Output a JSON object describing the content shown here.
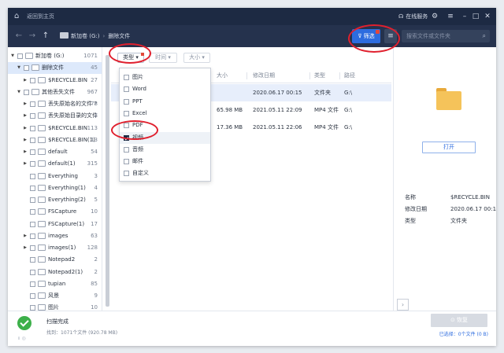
{
  "titlebar": {
    "home_icon": "home-icon",
    "back_home": "返回到主页",
    "online_service": "在线服务",
    "buttons": [
      "gear-icon",
      "menu-icon",
      "minimize-icon",
      "maximize-icon",
      "close-icon"
    ]
  },
  "navbar": {
    "path": [
      "新加卷 (G:)",
      "删除文件"
    ],
    "filter_label": "筛选",
    "search_placeholder": "搜索文件或文件夹"
  },
  "tree": [
    {
      "label": "新加卷 (G:)",
      "count": "1071",
      "level": 0,
      "expanded": true
    },
    {
      "label": "删除文件",
      "count": "45",
      "level": 1,
      "expanded": true,
      "selected": true
    },
    {
      "label": "$RECYCLE.BIN",
      "count": "27",
      "level": 2,
      "expanded": false
    },
    {
      "label": "其他丢失文件",
      "count": "967",
      "level": 1,
      "expanded": true
    },
    {
      "label": "丢失原始名的文件 ?",
      "count": "78",
      "level": 2,
      "expanded": false
    },
    {
      "label": "丢失原始目录的文件",
      "count": "2",
      "level": 2,
      "expanded": false
    },
    {
      "label": "$RECYCLE.BIN",
      "count": "113",
      "level": 2,
      "expanded": false
    },
    {
      "label": "$RECYCLE.BIN(1)",
      "count": "13",
      "level": 2,
      "expanded": false
    },
    {
      "label": "default",
      "count": "54",
      "level": 2,
      "expanded": false
    },
    {
      "label": "default(1)",
      "count": "315",
      "level": 2,
      "expanded": false
    },
    {
      "label": "Everything",
      "count": "3",
      "level": 2
    },
    {
      "label": "Everything(1)",
      "count": "4",
      "level": 2
    },
    {
      "label": "Everything(2)",
      "count": "5",
      "level": 2
    },
    {
      "label": "FSCapture",
      "count": "10",
      "level": 2
    },
    {
      "label": "FSCapture(1)",
      "count": "17",
      "level": 2
    },
    {
      "label": "images",
      "count": "63",
      "level": 2,
      "expanded": false
    },
    {
      "label": "images(1)",
      "count": "128",
      "level": 2,
      "expanded": false
    },
    {
      "label": "Notepad2",
      "count": "2",
      "level": 2
    },
    {
      "label": "Notepad2(1)",
      "count": "2",
      "level": 2
    },
    {
      "label": "tupian",
      "count": "85",
      "level": 2
    },
    {
      "label": "风景",
      "count": "9",
      "level": 2
    },
    {
      "label": "图片",
      "count": "10",
      "level": 2
    }
  ],
  "list": {
    "filters": [
      "类型",
      "时间",
      "大小"
    ],
    "columns": [
      "大小",
      "修改日期",
      "类型",
      "路径"
    ],
    "rows": [
      {
        "size": "",
        "date": "2020.06.17 00:15",
        "type": "文件夹",
        "path": "G:\\"
      },
      {
        "size": "65.98 MB",
        "date": "2021.05.11 22:09",
        "type": "MP4 文件",
        "path": "G:\\"
      },
      {
        "size": "17.36 MB",
        "date": "2021.05.11 22:06",
        "type": "MP4 文件",
        "path": "G:\\"
      }
    ]
  },
  "dropdown": {
    "items": [
      {
        "label": "图片",
        "checked": false
      },
      {
        "label": "Word",
        "checked": false
      },
      {
        "label": "PPT",
        "checked": false
      },
      {
        "label": "Excel",
        "checked": false
      },
      {
        "label": "PDF",
        "checked": false
      },
      {
        "label": "视频",
        "checked": true
      },
      {
        "label": "音频",
        "checked": false
      },
      {
        "label": "邮件",
        "checked": false
      },
      {
        "label": "自定义",
        "checked": false
      }
    ]
  },
  "preview": {
    "open_label": "打开",
    "props": [
      {
        "key": "名称",
        "value": "$RECYCLE.BIN"
      },
      {
        "key": "修改日期",
        "value": "2020.06.17 00:15"
      },
      {
        "key": "类型",
        "value": "文件夹"
      }
    ]
  },
  "footer": {
    "status": "扫描完成",
    "found": "找到：1071个文件 (920.78 MB)",
    "mini": "॥  ◎",
    "recover_label": "⊙ 恢复",
    "selected_info": "已选择：0个文件 (0 B)"
  },
  "colors": {
    "accent": "#2d6cdf",
    "titlebar": "#1d2a43",
    "success": "#3db04a",
    "annotation": "#e0202e"
  }
}
